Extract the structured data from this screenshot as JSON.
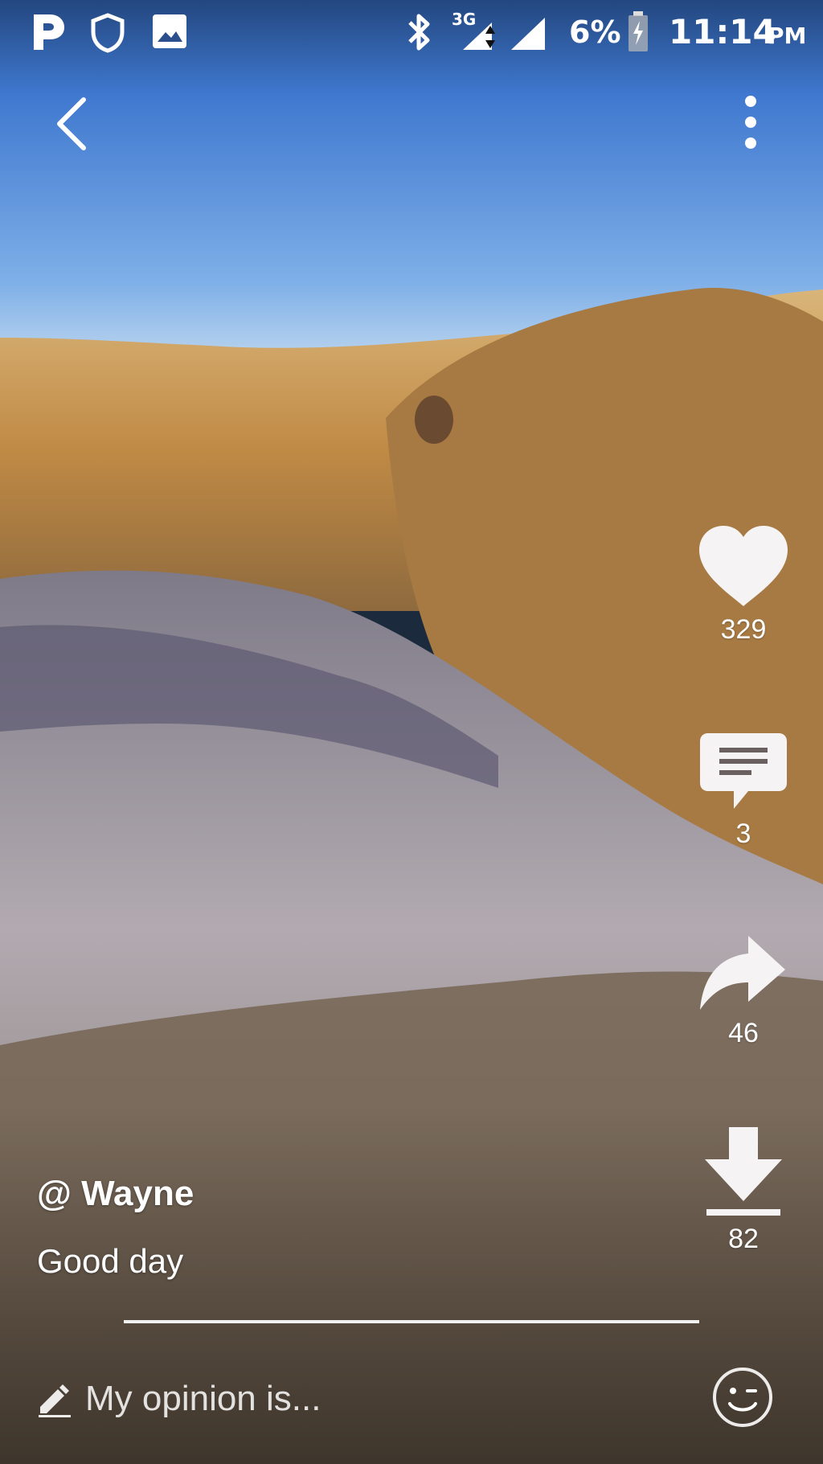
{
  "status_bar": {
    "battery_percent": "6%",
    "time": "11:14",
    "ampm": "PM",
    "network_type": "3G"
  },
  "post": {
    "author": "@ Wayne",
    "caption": "Good day"
  },
  "actions": {
    "likes": "329",
    "comments": "3",
    "shares": "46",
    "downloads": "82"
  },
  "comment_box": {
    "placeholder": "My opinion is..."
  },
  "colors": {
    "sky_top": "#2f62b8",
    "sky_bottom": "#b8d4ee",
    "grass": "#c99a52",
    "ground": "#9a9398"
  }
}
